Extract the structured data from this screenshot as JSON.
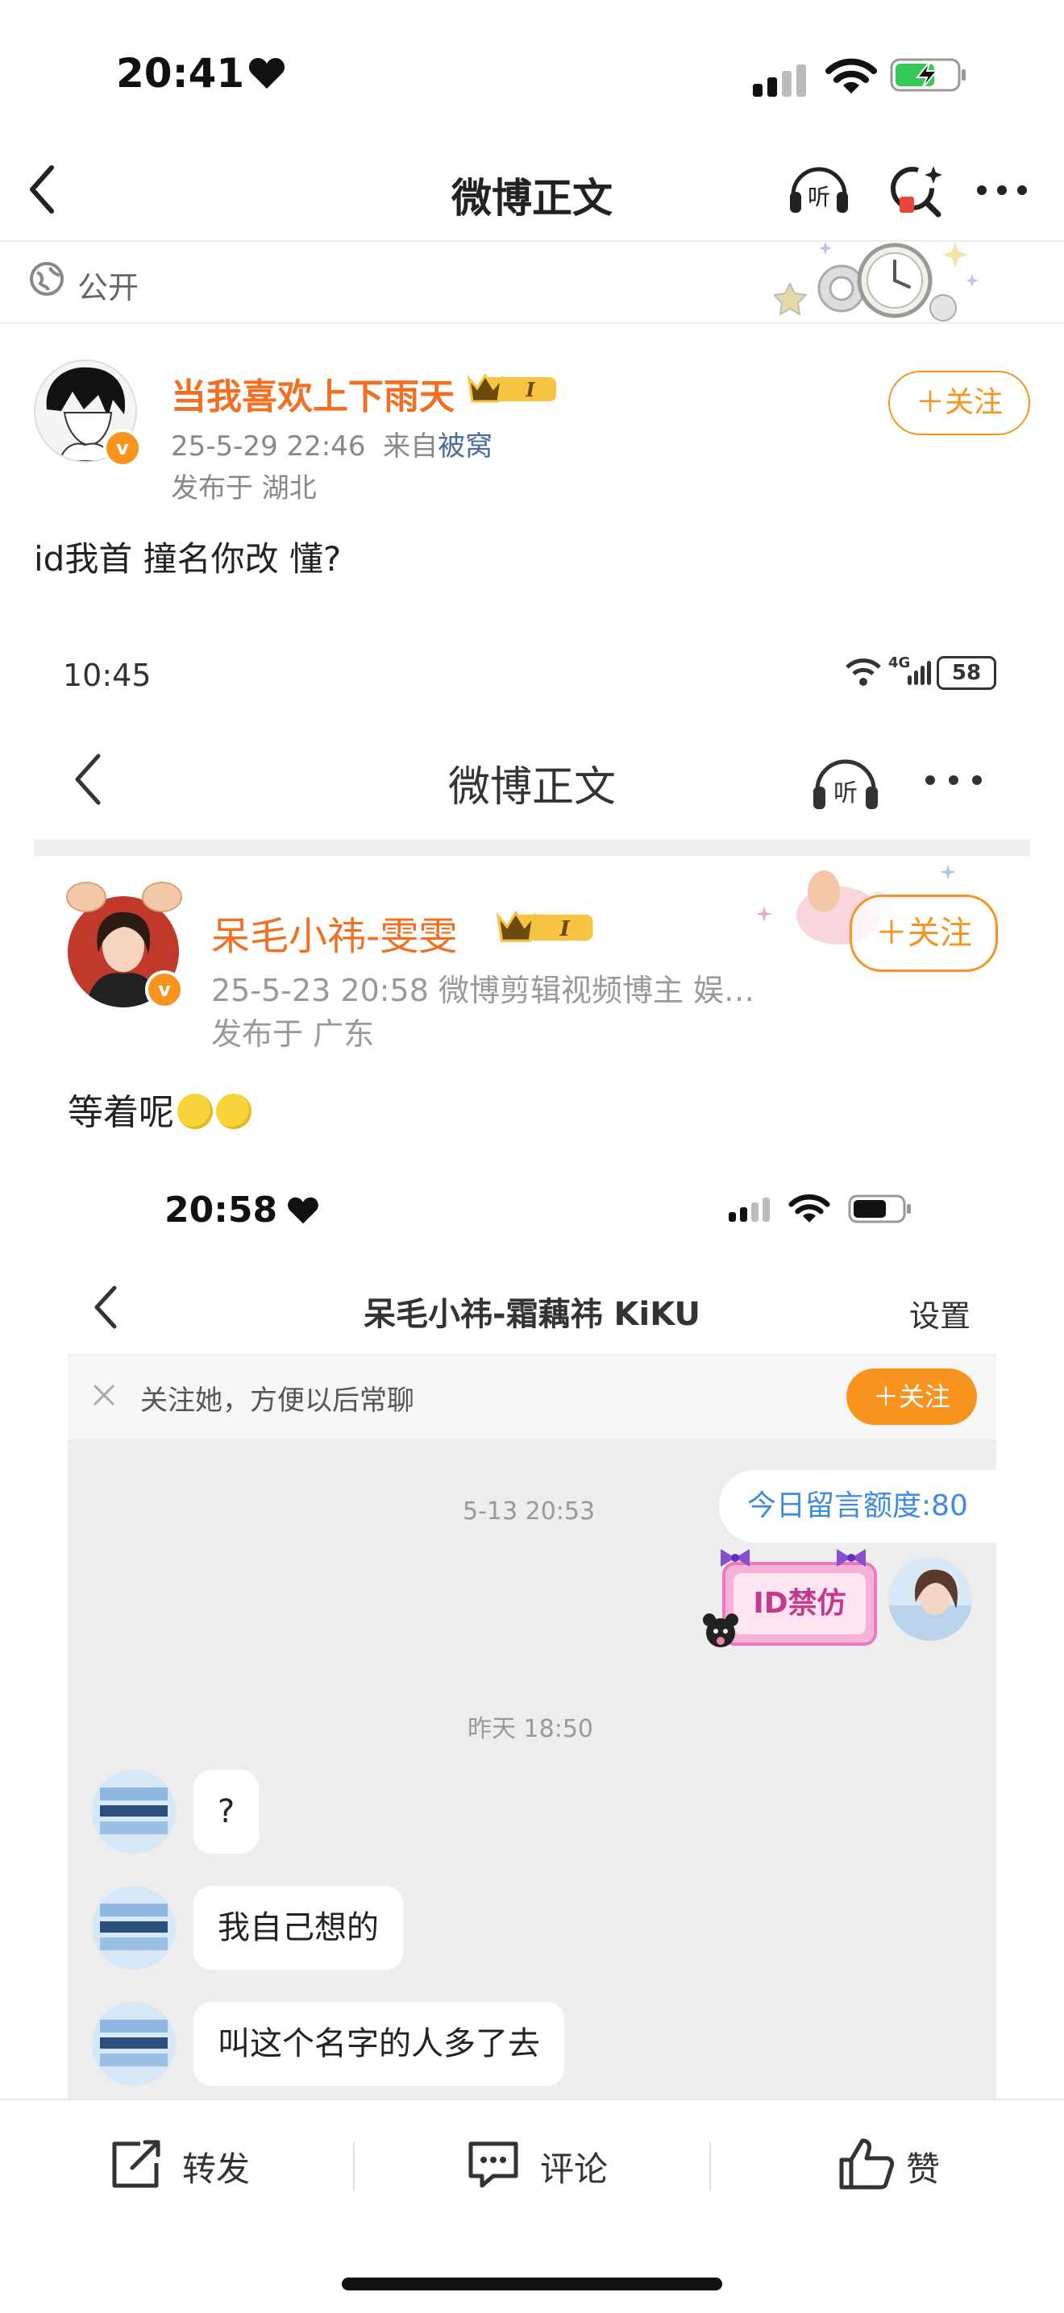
{
  "status_bar": {
    "time": "20:41"
  },
  "nav": {
    "title": "微博正文"
  },
  "visibility": {
    "label": "公开"
  },
  "post": {
    "author": "当我喜欢上下雨天",
    "badge_level": "I",
    "datetime": "25-5-29 22:46",
    "source_prefix": "来自",
    "source": "被窝",
    "location": "发布于 湖北",
    "follow_label": "＋关注",
    "text": "id我首 撞名你改 懂?"
  },
  "shot1": {
    "status_time": "10:45",
    "network": "4G",
    "battery": "58",
    "nav_title": "微博正文",
    "author": "呆毛小祎-雯雯",
    "badge_level": "I",
    "meta": "25-5-23 20:58  微博剪辑视频博主 娱…",
    "location": "发布于 广东",
    "follow_label": "＋关注",
    "text": "等着呢"
  },
  "shot2": {
    "status_time": "20:58",
    "chat_title": "呆毛小祎-霜藕祎 KiKU",
    "settings": "设置",
    "follow_tip": "关注她，方便以后常聊",
    "follow_label": "＋关注",
    "quota": "今日留言额度:80",
    "time1": "5-13 20:53",
    "sticker_text": "ID禁仿",
    "time2": "昨天 18:50",
    "messages": [
      "?",
      "我自己想的",
      "叫这个名字的人多了去"
    ]
  },
  "bottom_bar": {
    "repost": "转发",
    "comment": "评论",
    "like": "赞"
  },
  "colors": {
    "accent": "#f7931e",
    "username": "#f26f21",
    "link": "#4a6a9b"
  }
}
